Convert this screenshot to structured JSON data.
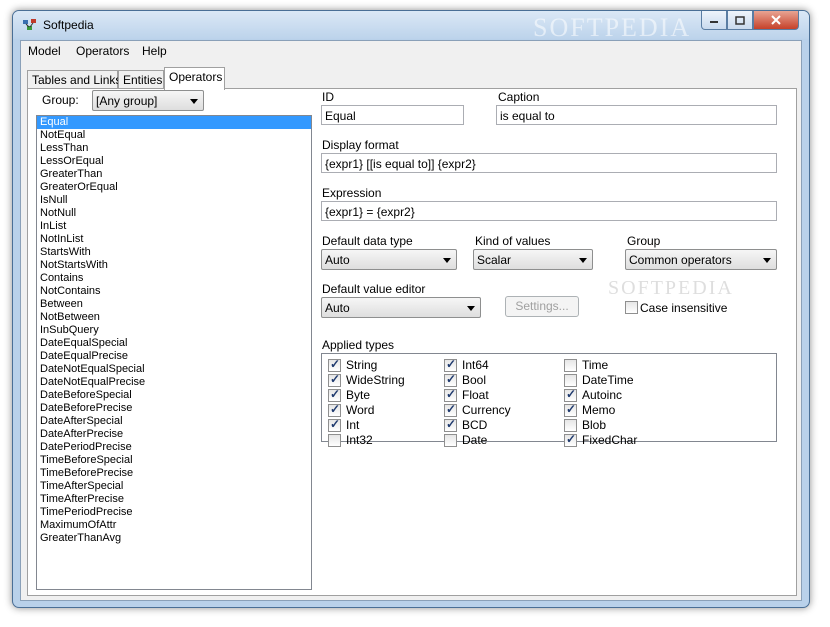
{
  "window": {
    "title": "Softpedia",
    "watermark": "SOFTPEDIA"
  },
  "menu": [
    "Model",
    "Operators",
    "Help"
  ],
  "tabs": [
    {
      "label": "Tables and Links",
      "active": false
    },
    {
      "label": "Entities",
      "active": false
    },
    {
      "label": "Operators",
      "active": true
    }
  ],
  "left": {
    "group_label": "Group:",
    "group_value": "[Any group]",
    "selected_index": 0,
    "items": [
      "Equal",
      "NotEqual",
      "LessThan",
      "LessOrEqual",
      "GreaterThan",
      "GreaterOrEqual",
      "IsNull",
      "NotNull",
      "InList",
      "NotInList",
      "StartsWith",
      "NotStartsWith",
      "Contains",
      "NotContains",
      "Between",
      "NotBetween",
      "InSubQuery",
      "DateEqualSpecial",
      "DateEqualPrecise",
      "DateNotEqualSpecial",
      "DateNotEqualPrecise",
      "DateBeforeSpecial",
      "DateBeforePrecise",
      "DateAfterSpecial",
      "DateAfterPrecise",
      "DatePeriodPrecise",
      "TimeBeforeSpecial",
      "TimeBeforePrecise",
      "TimeAfterSpecial",
      "TimeAfterPrecise",
      "TimePeriodPrecise",
      "MaximumOfAttr",
      "GreaterThanAvg"
    ]
  },
  "form": {
    "id_label": "ID",
    "id_value": "Equal",
    "caption_label": "Caption",
    "caption_value": "is equal to",
    "display_format_label": "Display format",
    "display_format_value": "{expr1} [[is equal to]] {expr2}",
    "expression_label": "Expression",
    "expression_value": "{expr1} = {expr2}",
    "data_type_label": "Default data type",
    "data_type_value": "Auto",
    "kind_label": "Kind of values",
    "kind_value": "Scalar",
    "group_label": "Group",
    "group_value": "Common operators",
    "editor_label": "Default value editor",
    "editor_value": "Auto",
    "settings_button": "Settings...",
    "case_insensitive_label": "Case insensitive",
    "case_insensitive_checked": false,
    "applied_types_label": "Applied types",
    "applied_types": [
      [
        {
          "label": "String",
          "checked": true
        },
        {
          "label": "WideString",
          "checked": true
        },
        {
          "label": "Byte",
          "checked": true
        },
        {
          "label": "Word",
          "checked": true
        },
        {
          "label": "Int",
          "checked": true
        },
        {
          "label": "Int32",
          "checked": false
        }
      ],
      [
        {
          "label": "Int64",
          "checked": true
        },
        {
          "label": "Bool",
          "checked": true
        },
        {
          "label": "Float",
          "checked": true
        },
        {
          "label": "Currency",
          "checked": true
        },
        {
          "label": "BCD",
          "checked": true
        },
        {
          "label": "Date",
          "checked": false
        }
      ],
      [
        {
          "label": "Time",
          "checked": false
        },
        {
          "label": "DateTime",
          "checked": false
        },
        {
          "label": "Autoinc",
          "checked": true
        },
        {
          "label": "Memo",
          "checked": true
        },
        {
          "label": "Blob",
          "checked": false
        },
        {
          "label": "FixedChar",
          "checked": true
        }
      ]
    ]
  }
}
